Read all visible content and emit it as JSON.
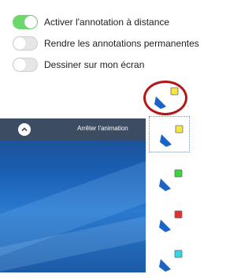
{
  "toggles": [
    {
      "label": "Activer l'annotation à distance",
      "on": true
    },
    {
      "label": "Rendre les annotations permanentes",
      "on": false
    },
    {
      "label": "Dessiner sur mon écran",
      "on": false
    }
  ],
  "video": {
    "stop_animation_label": "Arrêter l'animation"
  },
  "pens": [
    {
      "icon": "pen-icon",
      "color": "#f2e640"
    },
    {
      "icon": "pen-icon",
      "color": "#f2e640"
    },
    {
      "icon": "pen-icon",
      "color": "#3ad43a"
    },
    {
      "icon": "pen-icon",
      "color": "#e23030"
    },
    {
      "icon": "pen-icon",
      "color": "#35d3e8"
    }
  ],
  "colors": {
    "accent_toggle": "#6dd66d",
    "highlight": "#b21a1a",
    "pen_body": "#1a63c8"
  }
}
